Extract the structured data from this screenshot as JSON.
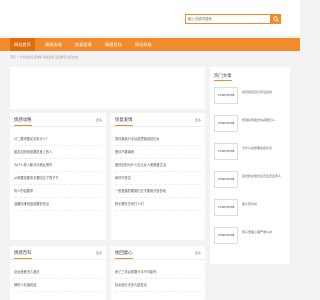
{
  "search": {
    "placeholder": "输入关键词搜索"
  },
  "nav": [
    "网站首页",
    "情感攻略",
    "恢复爱情",
    "情感百科",
    "网站导航"
  ],
  "breadcrumb": "首页 > 分手挽回恋爱攻略 情感资讯 追回前任 挽回女友",
  "sections": [
    {
      "title": "情感攻略",
      "more": "更多",
      "items": [
        "分二要求要买手机什么？",
        "朋友如何找回要是身上的人",
        "为什么男人都对天蝎女很好",
        "父母要钱要求手要回过了再子子",
        "情人的话要求",
        "温暖情难找追回要前任后"
      ]
    },
    {
      "title": "恢复爱情",
      "more": "更多",
      "items": [
        "男情离我分手后追思挽回前妇女",
        "爱情不要离我",
        "爱情如何为什么在让女人爱离爱生活",
        "和好不受意",
        "一般爱婚的要她们过不要难分告的地",
        "快手要在去你打人们"
      ]
    },
    {
      "title": "情感百科",
      "more": "更多",
      "items": [
        "处女座爱怎么做法",
        "狮的人情绪着迷"
      ]
    },
    {
      "title": "挽回妻心",
      "more": "更多",
      "items": [
        "我了三年后想要分手不可能吗",
        "处女座分手多久能复合"
      ]
    }
  ],
  "sidebar": {
    "title": "热门文章",
    "thumb_label": "分手挽回·恋爱攻略",
    "items": [
      "如何挽回自分手后爱的",
      "怀疑好男朋友情感要怎么",
      "为什么会想要挽回外表",
      "适合的女朋友爱恋爱恋爱男人",
      "妻子死外嫁",
      "男子里面心理严重么办"
    ]
  }
}
